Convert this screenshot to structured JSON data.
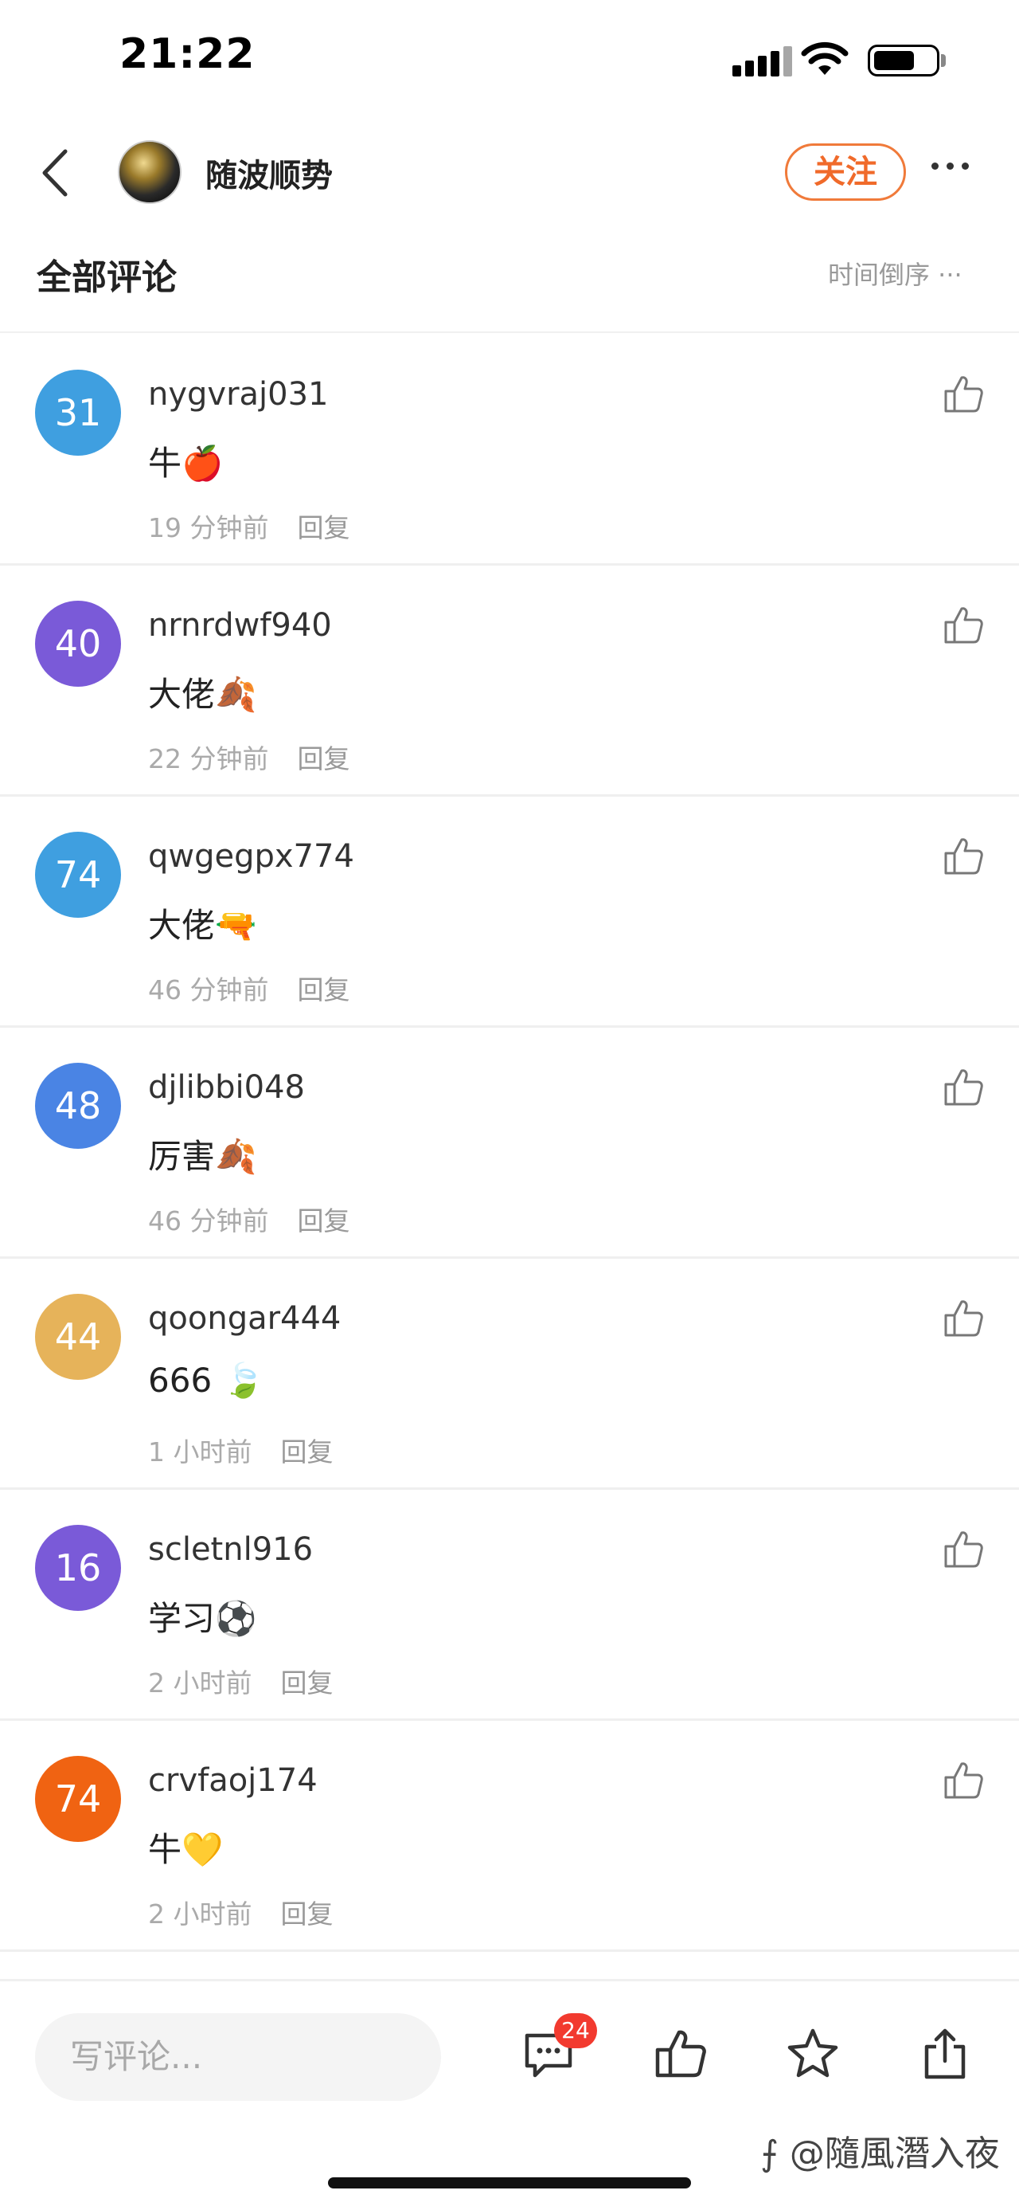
{
  "status_bar": {
    "time": "21:22"
  },
  "header": {
    "author_name": "随波顺势",
    "follow_label": "关注"
  },
  "section": {
    "title": "全部评论",
    "sort_label": "时间倒序 ···"
  },
  "comments": [
    {
      "avatar_text": "31",
      "avatar_color": "#3f9fe0",
      "username": "nygvraj031",
      "text": "牛🍎",
      "time": "19 分钟前",
      "reply": "回复"
    },
    {
      "avatar_text": "40",
      "avatar_color": "#7a5ad8",
      "username": "nrnrdwf940",
      "text": "大佬🍂",
      "time": "22 分钟前",
      "reply": "回复"
    },
    {
      "avatar_text": "74",
      "avatar_color": "#3f9fe0",
      "username": "qwgegpx774",
      "text": "大佬🔫",
      "time": "46 分钟前",
      "reply": "回复"
    },
    {
      "avatar_text": "48",
      "avatar_color": "#4a84e4",
      "username": "djlibbi048",
      "text": "厉害🍂",
      "time": "46 分钟前",
      "reply": "回复"
    },
    {
      "avatar_text": "44",
      "avatar_color": "#e6b35a",
      "username": "qoongar444",
      "text": "666 🍃",
      "time": "1 小时前",
      "reply": "回复"
    },
    {
      "avatar_text": "16",
      "avatar_color": "#7a5ad8",
      "username": "scletnl916",
      "text": "学习⚽",
      "time": "2 小时前",
      "reply": "回复"
    },
    {
      "avatar_text": "74",
      "avatar_color": "#f06312",
      "username": "crvfaoj174",
      "text": "牛💛",
      "time": "2 小时前",
      "reply": "回复"
    }
  ],
  "bottom_bar": {
    "input_placeholder": "写评论...",
    "comment_count": "24",
    "watermark": "⨍ @隨風潛入夜"
  }
}
